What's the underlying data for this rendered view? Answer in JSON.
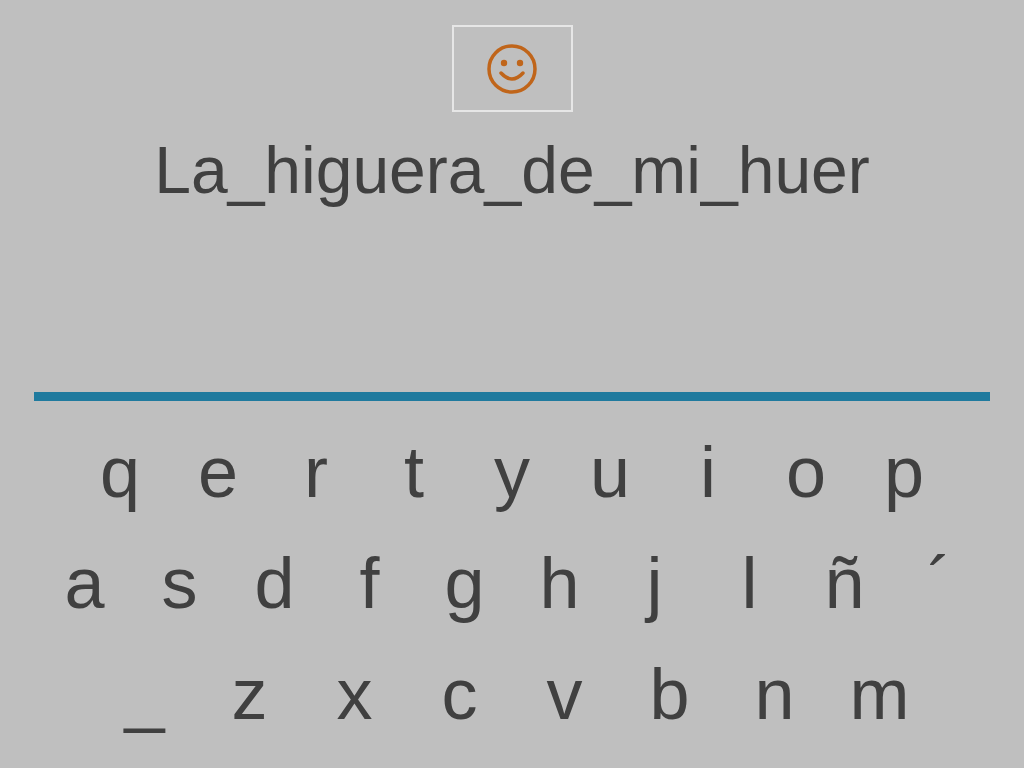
{
  "phrase": "La_higuera_de_mi_huer",
  "keyboard": {
    "rows": [
      [
        "q",
        "e",
        "r",
        "t",
        "y",
        "u",
        "i",
        "o",
        "p"
      ],
      [
        "a",
        "s",
        "d",
        "f",
        "g",
        "h",
        "j",
        "l",
        "ñ",
        "´"
      ],
      [
        "_",
        "z",
        "x",
        "c",
        "v",
        "b",
        "n",
        "m"
      ]
    ]
  }
}
